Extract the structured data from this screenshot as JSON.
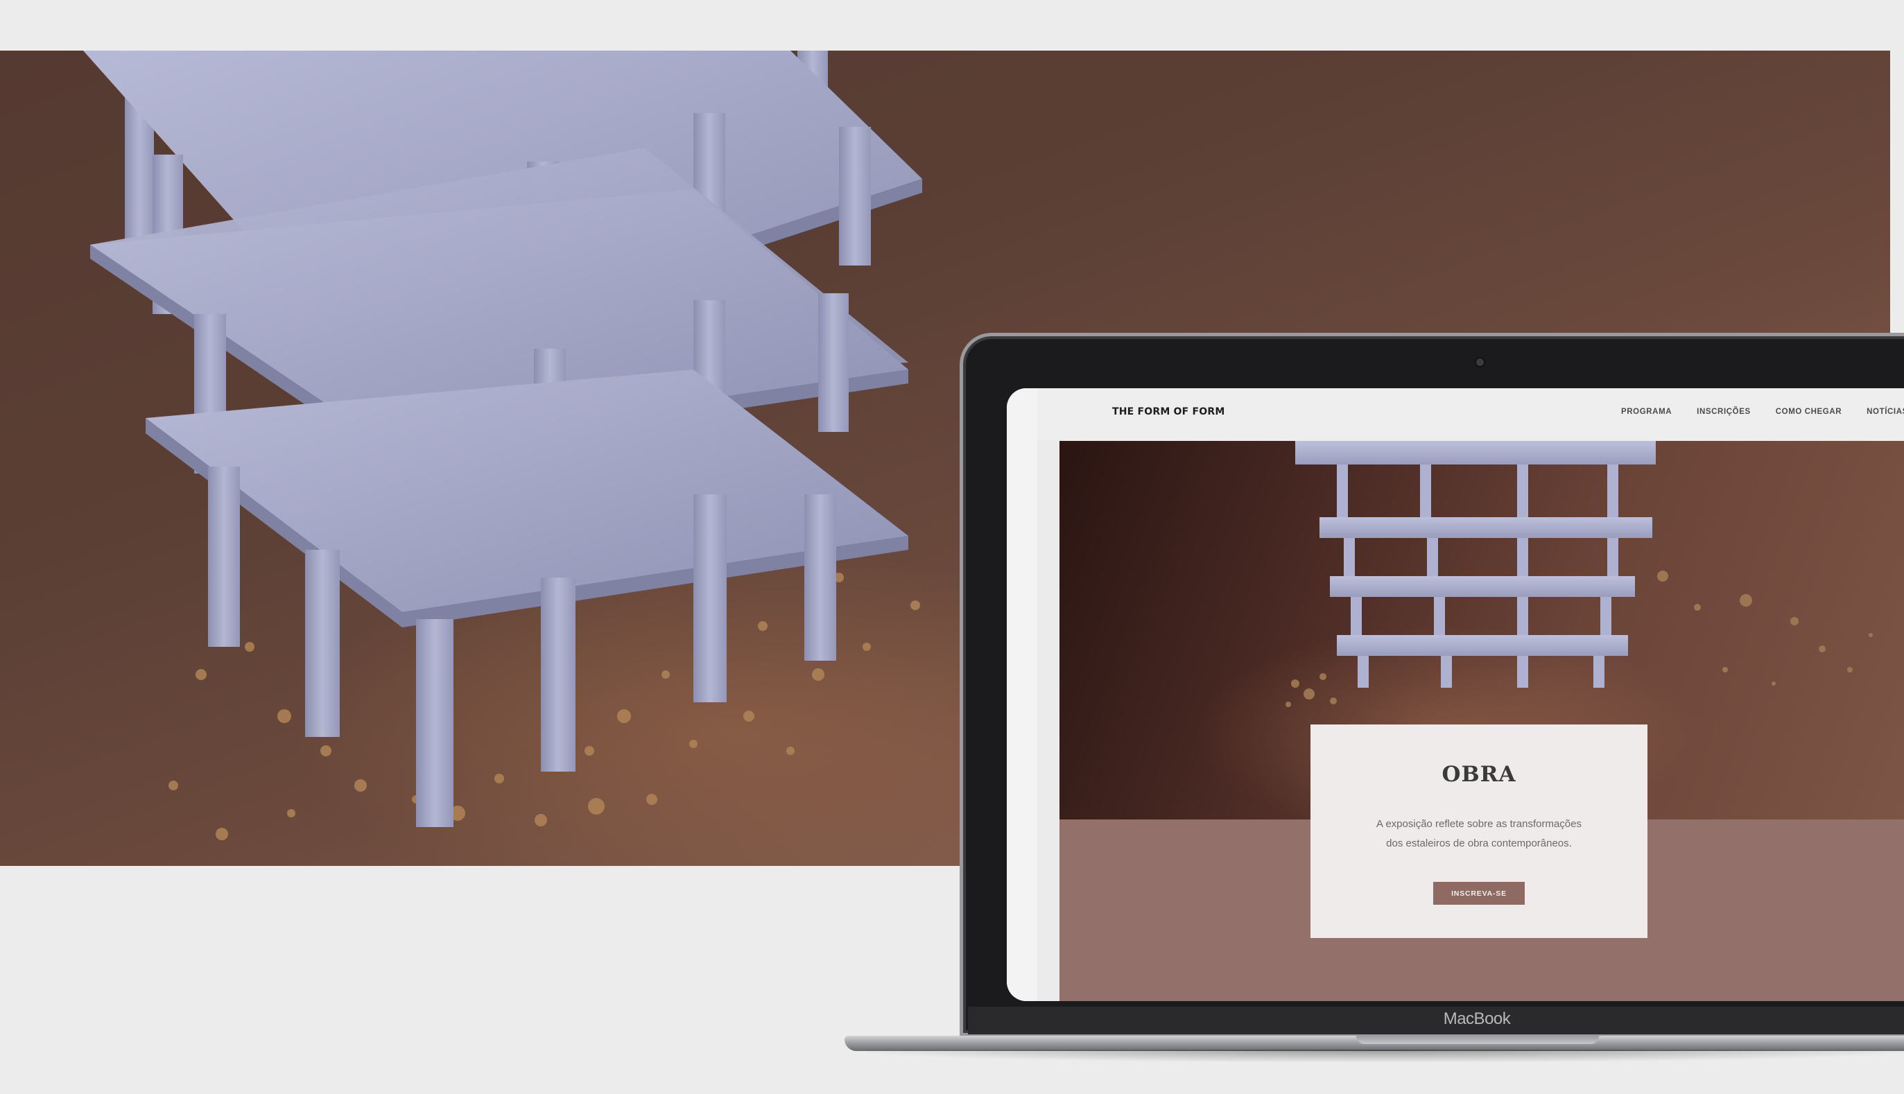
{
  "device": {
    "brand_label": "MacBook"
  },
  "site": {
    "logo": "THE FORM OF FORM",
    "nav": [
      {
        "label": "PROGRAMA"
      },
      {
        "label": "INSCRIÇÕES"
      },
      {
        "label": "COMO CHEGAR"
      },
      {
        "label": "NOTÍCIAS"
      }
    ],
    "hero": {
      "title": "OBRA",
      "text_line1": "A exposição reflete sobre as transformações",
      "text_line2": "dos estaleiros de obra contemporâneos.",
      "cta_label": "INSCREVA-SE"
    }
  },
  "colors": {
    "page_bg": "#ececec",
    "banner_brown": "#5b3f35",
    "model_lavender": "#a9acc9",
    "site_band": "#94706a",
    "cta_bg": "#8e6a62"
  },
  "icons": [
    "camera-icon"
  ]
}
